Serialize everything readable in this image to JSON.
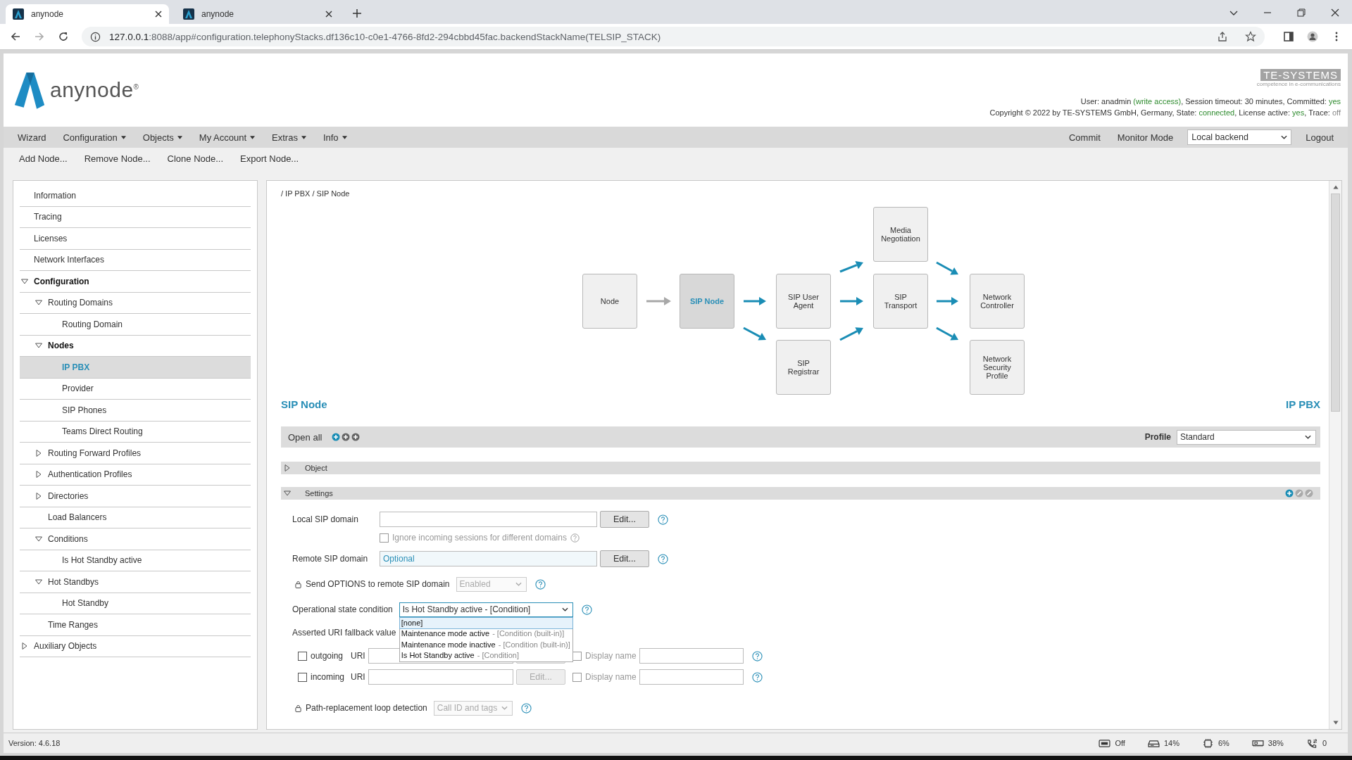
{
  "browser": {
    "tabs": [
      {
        "title": "anynode",
        "selected": true
      },
      {
        "title": "anynode",
        "selected": false
      }
    ],
    "url": {
      "host": "127.0.0.1",
      "path": ":8088/app#configuration.telephonyStacks.df136c10-c0e1-4766-8fd2-294cbbd45fac.backendStackName(TELSIP_STACK)"
    }
  },
  "header": {
    "logo": "anynode$^{®}$",
    "vendor_logo": {
      "name": "TE-SYSTEMS",
      "tagline": "competence in e-communications"
    },
    "status_lines": [
      [
        {
          "text": "User: anadmin "
        },
        {
          "text": "(write access)",
          "color": "#2e8b2e"
        },
        {
          "text": ", Session timeout: 30 minutes, Committed: "
        },
        {
          "text": "yes",
          "color": "#2e8b2e"
        }
      ],
      [
        {
          "text": "Copyright © 2022 by TE-SYSTEMS GmbH, Germany, State: "
        },
        {
          "text": "connected",
          "color": "#2e8b2e"
        },
        {
          "text": ", License active: "
        },
        {
          "text": "yes",
          "color": "#2e8b2e"
        },
        {
          "text": ", Trace: "
        },
        {
          "text": "off",
          "color": "#888888"
        }
      ]
    ]
  },
  "menu": {
    "items": [
      {
        "label": "Wizard",
        "dropdown": false
      },
      {
        "label": "Configuration",
        "dropdown": true
      },
      {
        "label": "Objects",
        "dropdown": true
      },
      {
        "label": "My Account",
        "dropdown": true
      },
      {
        "label": "Extras",
        "dropdown": true
      },
      {
        "label": "Info",
        "dropdown": true
      }
    ],
    "commit": "Commit",
    "monitor": "Monitor Mode",
    "backend": "Local backend",
    "logout": "Logout"
  },
  "toolbar": [
    "Add Node...",
    "Remove Node...",
    "Clone Node...",
    "Export Node..."
  ],
  "sidebar": {
    "items": [
      {
        "label": "Information",
        "selected": false,
        "bold": false
      },
      {
        "label": "Tracing",
        "selected": false,
        "bold": false
      },
      {
        "label": "Licenses",
        "selected": false,
        "bold": false
      },
      {
        "label": "Network Interfaces",
        "selected": false,
        "bold": false
      },
      {
        "label": "Configuration",
        "selected": false,
        "bold": true,
        "expanded": true,
        "children": [
          {
            "label": "Routing Domains",
            "selected": false,
            "bold": false,
            "expanded": true,
            "children": [
              {
                "label": "Routing Domain",
                "selected": false,
                "bold": false
              }
            ]
          },
          {
            "label": "Nodes",
            "selected": false,
            "bold": true,
            "expanded": true,
            "children": [
              {
                "label": "IP PBX",
                "selected": true,
                "bold": true
              },
              {
                "label": "Provider",
                "selected": false,
                "bold": false
              },
              {
                "label": "SIP Phones",
                "selected": false,
                "bold": false
              },
              {
                "label": "Teams Direct Routing",
                "selected": false,
                "bold": false
              }
            ]
          },
          {
            "label": "Routing Forward Profiles",
            "selected": false,
            "bold": false,
            "expanded": false
          },
          {
            "label": "Authentication Profiles",
            "selected": false,
            "bold": false,
            "expanded": false
          },
          {
            "label": "Directories",
            "selected": false,
            "bold": false,
            "expanded": false
          },
          {
            "label": "Load Balancers",
            "selected": false,
            "bold": false
          },
          {
            "label": "Conditions",
            "selected": false,
            "bold": false,
            "expanded": true,
            "children": [
              {
                "label": "Is Hot Standby active",
                "selected": false,
                "bold": false
              }
            ]
          },
          {
            "label": "Hot Standbys",
            "selected": false,
            "bold": false,
            "expanded": true,
            "children": [
              {
                "label": "Hot Standby",
                "selected": false,
                "bold": false
              }
            ]
          },
          {
            "label": "Time Ranges",
            "selected": false,
            "bold": false
          }
        ]
      },
      {
        "label": "Auxiliary Objects",
        "selected": false,
        "bold": false,
        "expanded": false
      }
    ]
  },
  "content": {
    "breadcrumb": "/ IP PBX / SIP Node",
    "diagram": {
      "nodes": [
        {
          "label": "Node",
          "selected": false
        },
        {
          "label": "SIP Node",
          "selected": true
        },
        {
          "label": "SIP User Agent",
          "selected": false
        },
        {
          "label": "SIP Registrar",
          "selected": false
        },
        {
          "label": "Media Negotiation",
          "selected": false
        },
        {
          "label": "SIP Transport",
          "selected": false
        },
        {
          "label": "Network Controller",
          "selected": false
        },
        {
          "label": "Network Security Profile",
          "selected": false
        }
      ],
      "arrows": [
        {
          "active": false
        },
        {
          "active": true
        },
        {
          "active": true
        },
        {
          "active": true
        },
        {
          "active": true
        },
        {
          "active": true
        },
        {
          "active": true
        },
        {
          "active": true
        },
        {
          "active": true
        }
      ]
    },
    "title": "SIP Node",
    "object_name": "IP PBX",
    "open_all": "Open all",
    "profile": {
      "label": "Profile",
      "value": "Standard"
    },
    "sections": [
      {
        "title": "Object",
        "expanded": false
      },
      {
        "title": "Settings",
        "expanded": true
      }
    ],
    "form": [
      {
        "kind": "text",
        "label": "Local SIP domain",
        "button": "Edit..."
      },
      {
        "kind": "checkbox",
        "label": "Ignore incoming sessions for different domains",
        "checked": false,
        "disabled": true
      },
      {
        "kind": "text",
        "label": "Remote SIP domain",
        "placeholder": "Optional",
        "button": "Edit..."
      },
      {
        "kind": "select",
        "label": "Send OPTIONS to remote SIP domain",
        "locked": true,
        "disabled": true,
        "value": "Enabled"
      },
      {
        "kind": "select",
        "label": "Operational state condition",
        "locked": false,
        "disabled": false,
        "value": "Is Hot Standby active - [Condition]",
        "options": [
          {
            "name": "[none]",
            "selected": true
          },
          {
            "name": "Maintenance mode active",
            "type": "- [Condition (built-in)]",
            "selected": false
          },
          {
            "name": "Maintenance mode inactive",
            "type": "- [Condition (built-in)]",
            "selected": false
          },
          {
            "name": "Is Hot Standby active",
            "type": "- [Condition]",
            "selected": false
          }
        ]
      },
      {
        "kind": "heading",
        "label": "Asserted URI fallback value"
      },
      {
        "kind": "uri",
        "label": "outgoing",
        "checked": false,
        "uri_label": "URI",
        "display_label": "Display name",
        "display_checked": false
      },
      {
        "kind": "uri",
        "label": "incoming",
        "checked": false,
        "uri_label": "URI",
        "button": "Edit...",
        "display_label": "Display name",
        "display_checked": false
      },
      {
        "kind": "select",
        "label": "Path-replacement loop detection",
        "locked": true,
        "disabled": true,
        "value": "Call ID and tags"
      }
    ]
  },
  "status_bar": {
    "version": "Version: 4.6.18",
    "items": [
      {
        "kind": "trace",
        "value": "Off"
      },
      {
        "kind": "disk",
        "value": "14%"
      },
      {
        "kind": "cpu",
        "value": "6%"
      },
      {
        "kind": "memory",
        "value": "38%"
      },
      {
        "kind": "calls",
        "value": "0"
      }
    ]
  }
}
